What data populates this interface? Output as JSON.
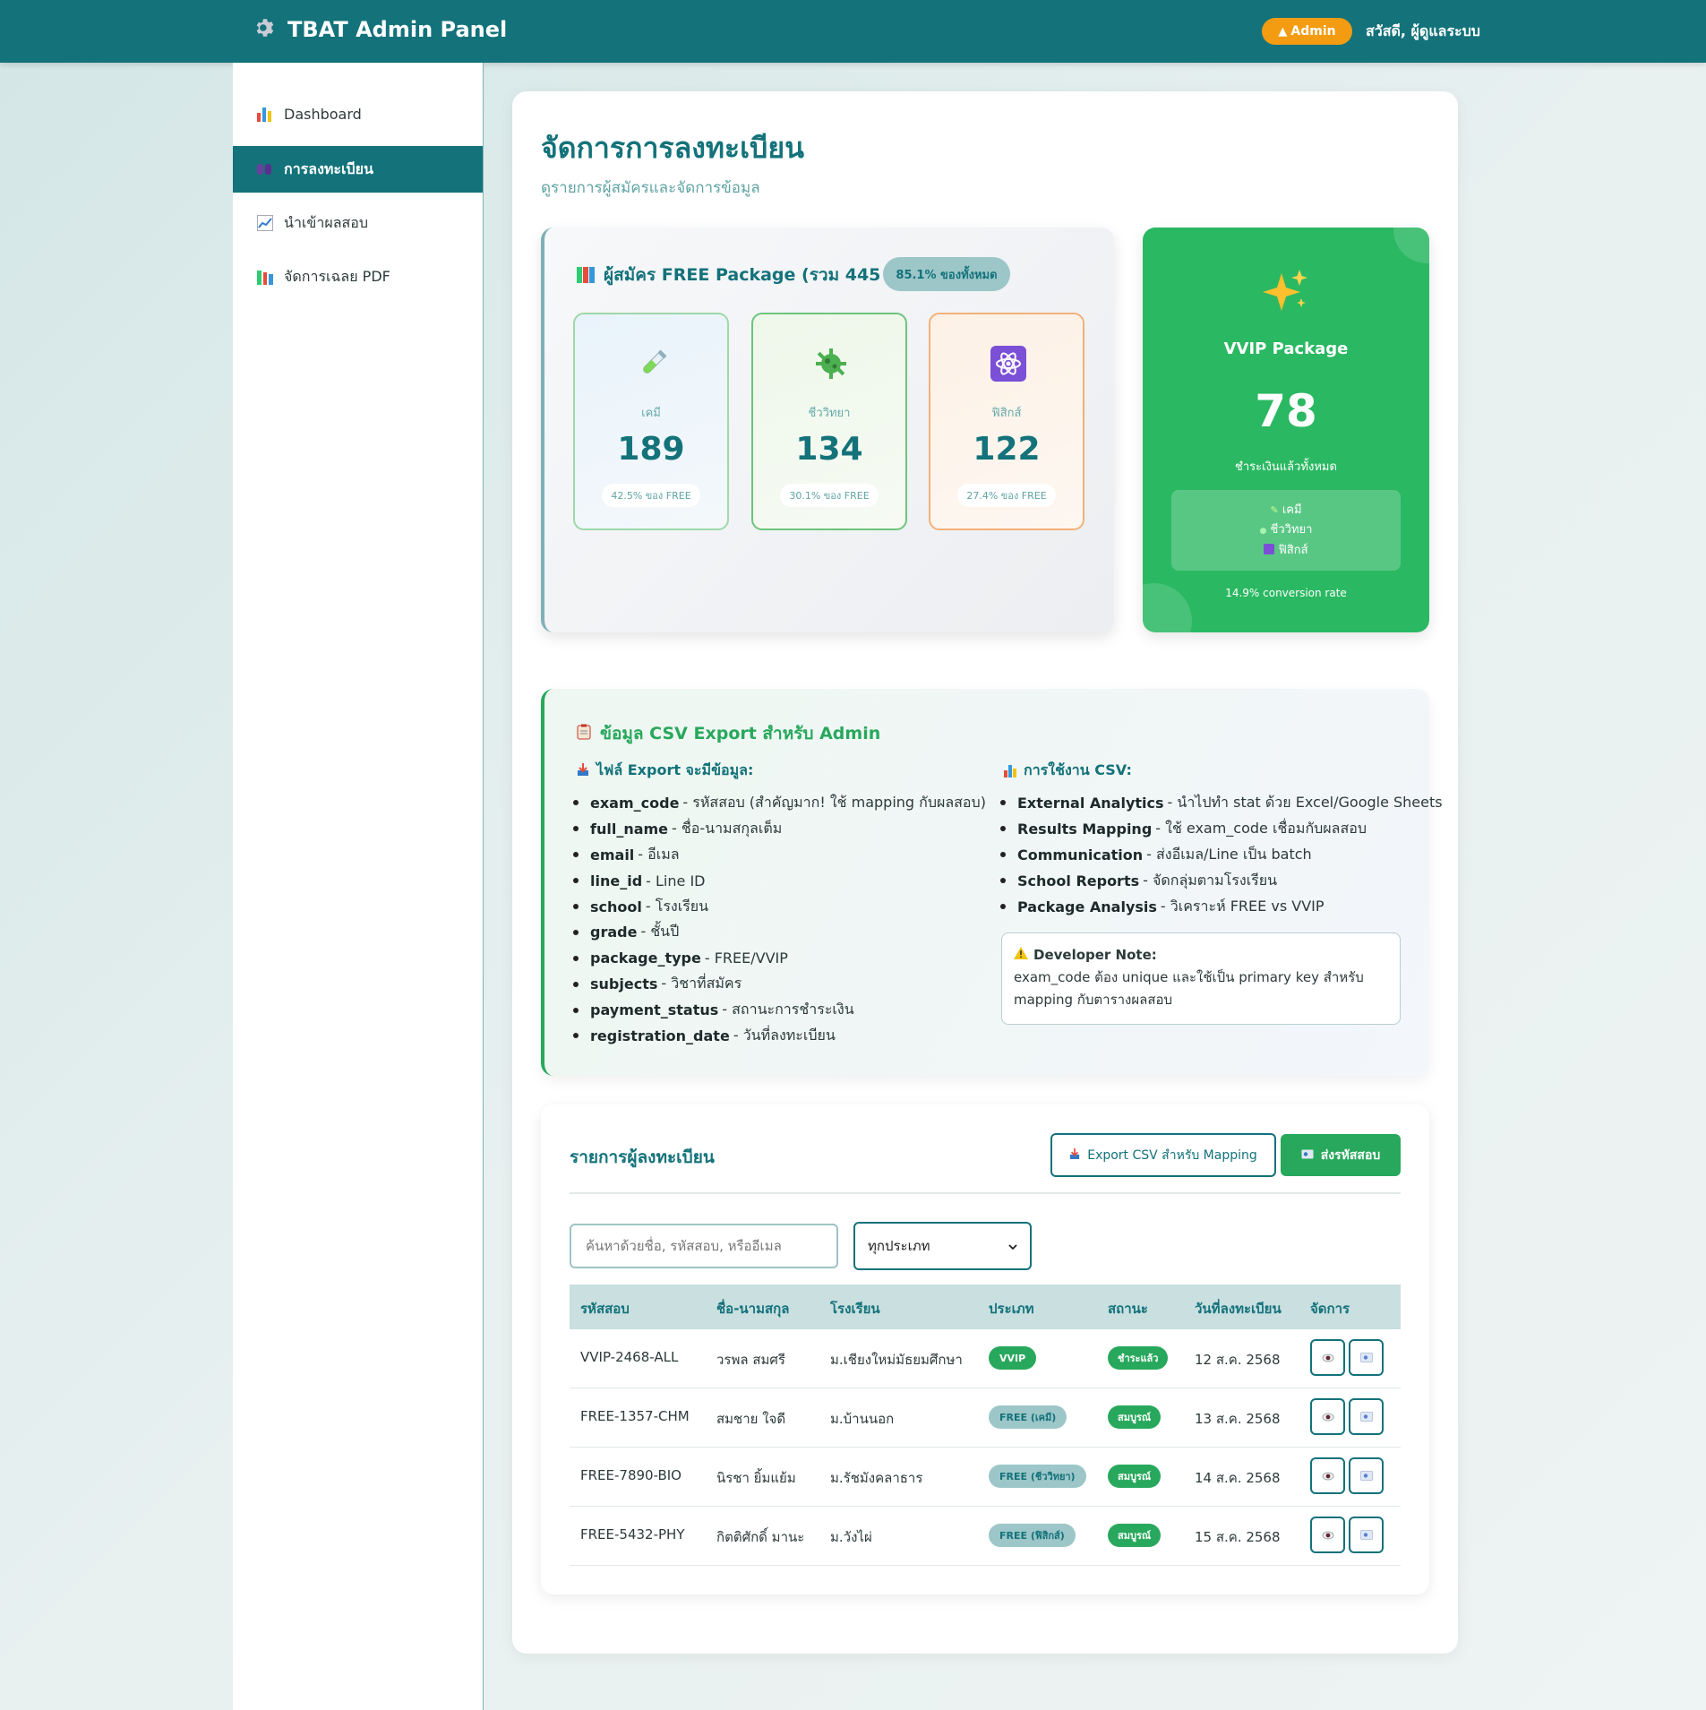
{
  "header": {
    "title": "TBAT Admin Panel",
    "admin_badge": "Admin",
    "greeting": "สวัสดี, ผู้ดูแลระบบ"
  },
  "sidebar": {
    "items": [
      {
        "label": "Dashboard",
        "icon": "bar-chart-icon",
        "active": false
      },
      {
        "label": "การลงทะเบียน",
        "icon": "users-icon",
        "active": true
      },
      {
        "label": "นำเข้าผลสอบ",
        "icon": "line-chart-icon",
        "active": false
      },
      {
        "label": "จัดการเฉลย PDF",
        "icon": "books-icon",
        "active": false
      }
    ]
  },
  "page": {
    "title": "จัดการการลงทะเบียน",
    "subtitle": "ดูรายการผู้สมัครและจัดการข้อมูล"
  },
  "free_package": {
    "title": "ผู้สมัคร FREE Package (รวม 445 คน)",
    "percent_badge": "85.1% ของทั้งหมด",
    "subjects": [
      {
        "name": "เคมี",
        "count": "189",
        "pct": "42.5% ของ FREE",
        "icon": "test-tube-icon"
      },
      {
        "name": "ชีววิทยา",
        "count": "134",
        "pct": "30.1% ของ FREE",
        "icon": "microbe-icon"
      },
      {
        "name": "ฟิสิกส์",
        "count": "122",
        "pct": "27.4% ของ FREE",
        "icon": "atom-icon"
      }
    ]
  },
  "vvip_package": {
    "name": "VVIP Package",
    "count": "78",
    "paid_label": "ชำระเงินแล้วทั้งหมด",
    "subjects": [
      "เคมี",
      "ชีววิทยา",
      "ฟิสิกส์"
    ],
    "conversion": "14.9% conversion rate"
  },
  "csv_info": {
    "title": "ข้อมูล CSV Export สำหรับ Admin",
    "fields_heading": "ไฟล์ Export จะมีข้อมูล:",
    "fields": [
      {
        "key": "exam_code",
        "desc": "- รหัสสอบ (สำคัญมาก! ใช้ mapping กับผลสอบ)"
      },
      {
        "key": "full_name",
        "desc": "- ชื่อ-นามสกุลเต็ม"
      },
      {
        "key": "email",
        "desc": "- อีเมล"
      },
      {
        "key": "line_id",
        "desc": "- Line ID"
      },
      {
        "key": "school",
        "desc": "- โรงเรียน"
      },
      {
        "key": "grade",
        "desc": "- ชั้นปี"
      },
      {
        "key": "package_type",
        "desc": "- FREE/VVIP"
      },
      {
        "key": "subjects",
        "desc": "- วิชาที่สมัคร"
      },
      {
        "key": "payment_status",
        "desc": "- สถานะการชำระเงิน"
      },
      {
        "key": "registration_date",
        "desc": "- วันที่ลงทะเบียน"
      }
    ],
    "usage_heading": "การใช้งาน CSV:",
    "usage": [
      {
        "key": "External Analytics",
        "desc": "- นำไปทำ stat ด้วย Excel/Google Sheets"
      },
      {
        "key": "Results Mapping",
        "desc": "- ใช้ exam_code เชื่อมกับผลสอบ"
      },
      {
        "key": "Communication",
        "desc": "- ส่งอีเมล/Line เป็น batch"
      },
      {
        "key": "School Reports",
        "desc": "- จัดกลุ่มตามโรงเรียน"
      },
      {
        "key": "Package Analysis",
        "desc": "- วิเคราะห์ FREE vs VVIP"
      }
    ],
    "dev_note_title": "Developer Note:",
    "dev_note_text": "exam_code ต้อง unique และใช้เป็น primary key สำหรับ mapping กับตารางผลสอบ"
  },
  "registrations": {
    "title": "รายการผู้ลงทะเบียน",
    "export_button": "Export CSV สำหรับ Mapping",
    "send_button": "ส่งรหัสสอบ",
    "search_placeholder": "ค้นหาด้วยชื่อ, รหัสสอบ, หรืออีเมล",
    "filter_value": "ทุกประเภท",
    "columns": [
      "รหัสสอบ",
      "ชื่อ-นามสกุล",
      "โรงเรียน",
      "ประเภท",
      "สถานะ",
      "วันที่ลงทะเบียน",
      "จัดการ"
    ],
    "rows": [
      {
        "code": "VVIP-2468-ALL",
        "name": "วรพล สมศรี",
        "school": "ม.เชียงใหม่มัธยมศึกษา",
        "type": "VVIP",
        "status": "ชำระแล้ว",
        "date": "12 ส.ค. 2568"
      },
      {
        "code": "FREE-1357-CHM",
        "name": "สมชาย ใจดี",
        "school": "ม.บ้านนอก",
        "type": "FREE (เคมี)",
        "status": "สมบูรณ์",
        "date": "13 ส.ค. 2568"
      },
      {
        "code": "FREE-7890-BIO",
        "name": "นิรชา ยิ้มแย้ม",
        "school": "ม.รัชมังคลาธาร",
        "type": "FREE (ชีววิทยา)",
        "status": "สมบูรณ์",
        "date": "14 ส.ค. 2568"
      },
      {
        "code": "FREE-5432-PHY",
        "name": "กิตติศักดิ์ มานะ",
        "school": "ม.วังไผ่",
        "type": "FREE (ฟิสิกส์)",
        "status": "สมบูรณ์",
        "date": "15 ส.ค. 2568"
      }
    ]
  },
  "colors": {
    "primary": "#13727a",
    "success": "#28a85c",
    "warning": "#f39c12"
  }
}
